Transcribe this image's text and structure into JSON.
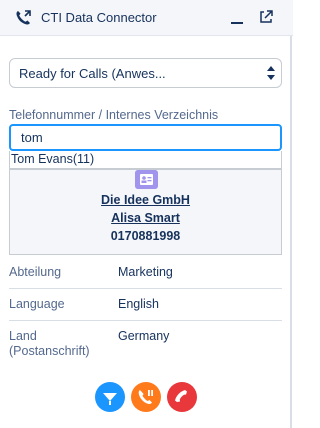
{
  "header": {
    "title": "CTI Data Connector",
    "icons": [
      "phone-icon",
      "minimize-icon",
      "popout-icon"
    ]
  },
  "status": {
    "selected": "Ready for Calls (Anwes..."
  },
  "search": {
    "label": "Telefonnummer / Internes Verzeichnis",
    "value": "tom",
    "suggestion": "Tom Evans(11)"
  },
  "contact_card": {
    "company": "Die Idee GmbH",
    "name": "Alisa Smart",
    "phone": "0170881998"
  },
  "fields": [
    {
      "label": "Abteilung",
      "value": "Marketing"
    },
    {
      "label": "Language",
      "value": "English"
    },
    {
      "label": "Land\n(Postanschrift)",
      "value": "Germany"
    }
  ],
  "actions": [
    {
      "name": "transfer",
      "color": "#1b96ff"
    },
    {
      "name": "hold",
      "color": "#ff7a1b"
    },
    {
      "name": "hangup",
      "color": "#e8383b"
    }
  ],
  "colors": {
    "accent": "#1b96ff",
    "text": "#16325c",
    "label": "#54698d",
    "contact_icon": "#a094ed"
  }
}
